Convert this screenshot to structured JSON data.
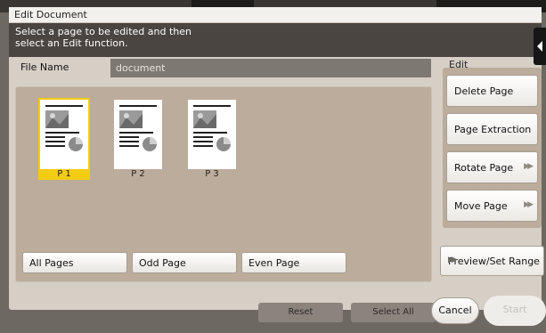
{
  "dialog": {
    "title": "Edit Document",
    "instruction": "Select a page to be edited and then\nselect an Edit function."
  },
  "file": {
    "label": "File Name",
    "value": "document"
  },
  "pages": [
    {
      "label": "P 1",
      "selected": true
    },
    {
      "label": "P 2",
      "selected": false
    },
    {
      "label": "P 3",
      "selected": false
    }
  ],
  "page_filters": {
    "all": "All Pages",
    "odd": "Odd Page",
    "even": "Even Page"
  },
  "edit": {
    "heading": "Edit",
    "delete": "Delete Page",
    "extract": "Page Extraction",
    "rotate": "Rotate Page",
    "move": "Move Page"
  },
  "preview_label": "Preview/Set Range",
  "background_buttons": {
    "reset": "Reset",
    "select_all": "Select All"
  },
  "footer": {
    "cancel": "Cancel",
    "start": "Start"
  },
  "colors": {
    "selected_highlight": "#f3cc14",
    "panel": "#bcac9b",
    "instruction_bar": "#4a4541"
  },
  "icons": {
    "collapse": "chevron-left-icon",
    "submenu": "double-chevron-right-icon",
    "page": "document-page-icon"
  }
}
